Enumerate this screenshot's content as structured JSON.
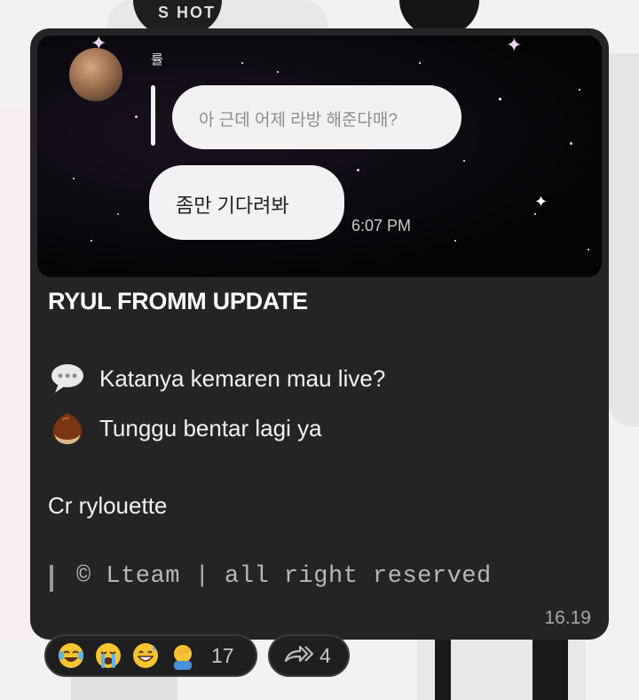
{
  "background": {
    "cap_text": "S HOT"
  },
  "photo": {
    "sender_name": "률",
    "reply_text": "아 근데 어제 라방 해준다매?",
    "message_text": "좀만 기다려봐",
    "message_time": "6:07 PM"
  },
  "post": {
    "title": "RYUL FROMM UPDATE",
    "lines": [
      {
        "icon": "speech-bubble-icon",
        "text": "Katanya kemaren mau live?"
      },
      {
        "icon": "chestnut-icon",
        "text": "Tunggu bentar lagi ya"
      }
    ],
    "credit": "Cr rylouette",
    "copyright": "© Lteam | all right reserved",
    "time": "16.19"
  },
  "reactions": {
    "emojis": [
      "face-with-tears-of-joy-icon",
      "loudly-crying-face-icon",
      "grinning-sweat-face-icon",
      "facepalm-icon"
    ],
    "count": "17"
  },
  "forward": {
    "count": "4"
  },
  "colors": {
    "card": "#242424",
    "bubble": "#f2f2f2",
    "pill": "#1f1f1f"
  }
}
